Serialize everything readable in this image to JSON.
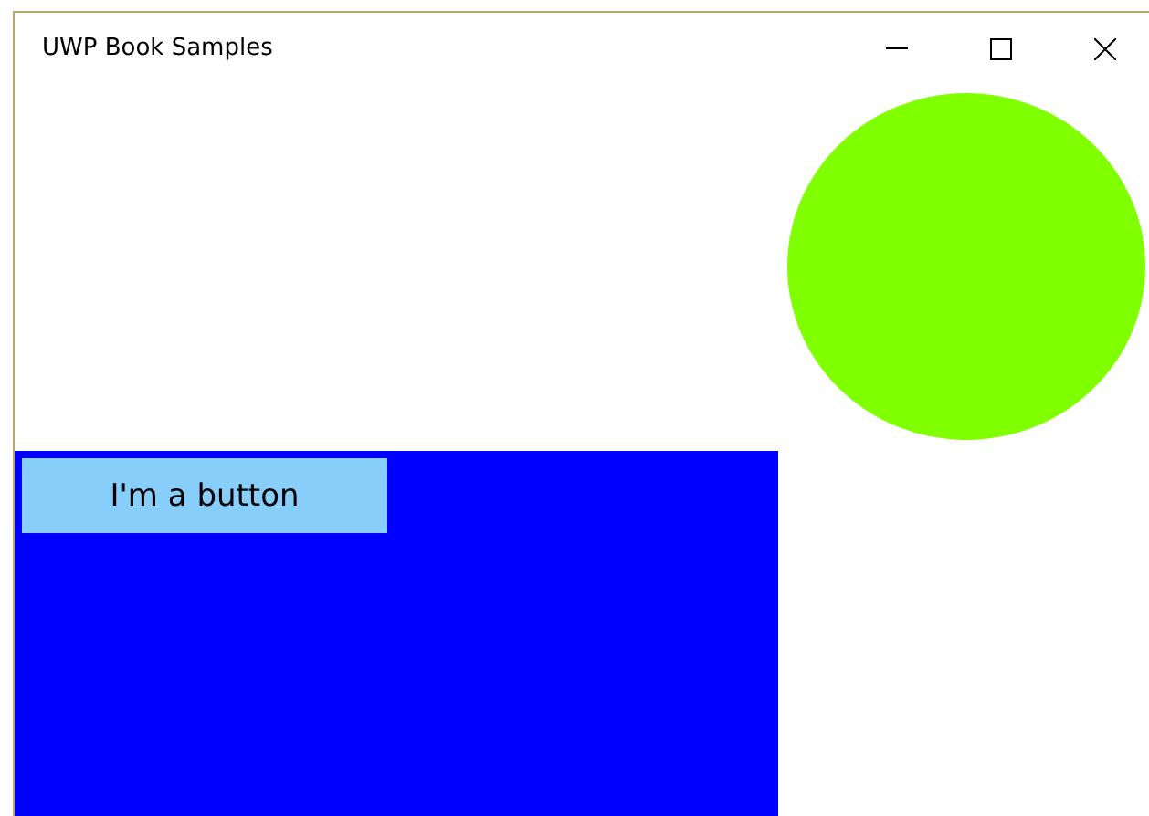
{
  "window": {
    "title": "UWP Book Samples"
  },
  "button": {
    "label": "I'm a button"
  }
}
